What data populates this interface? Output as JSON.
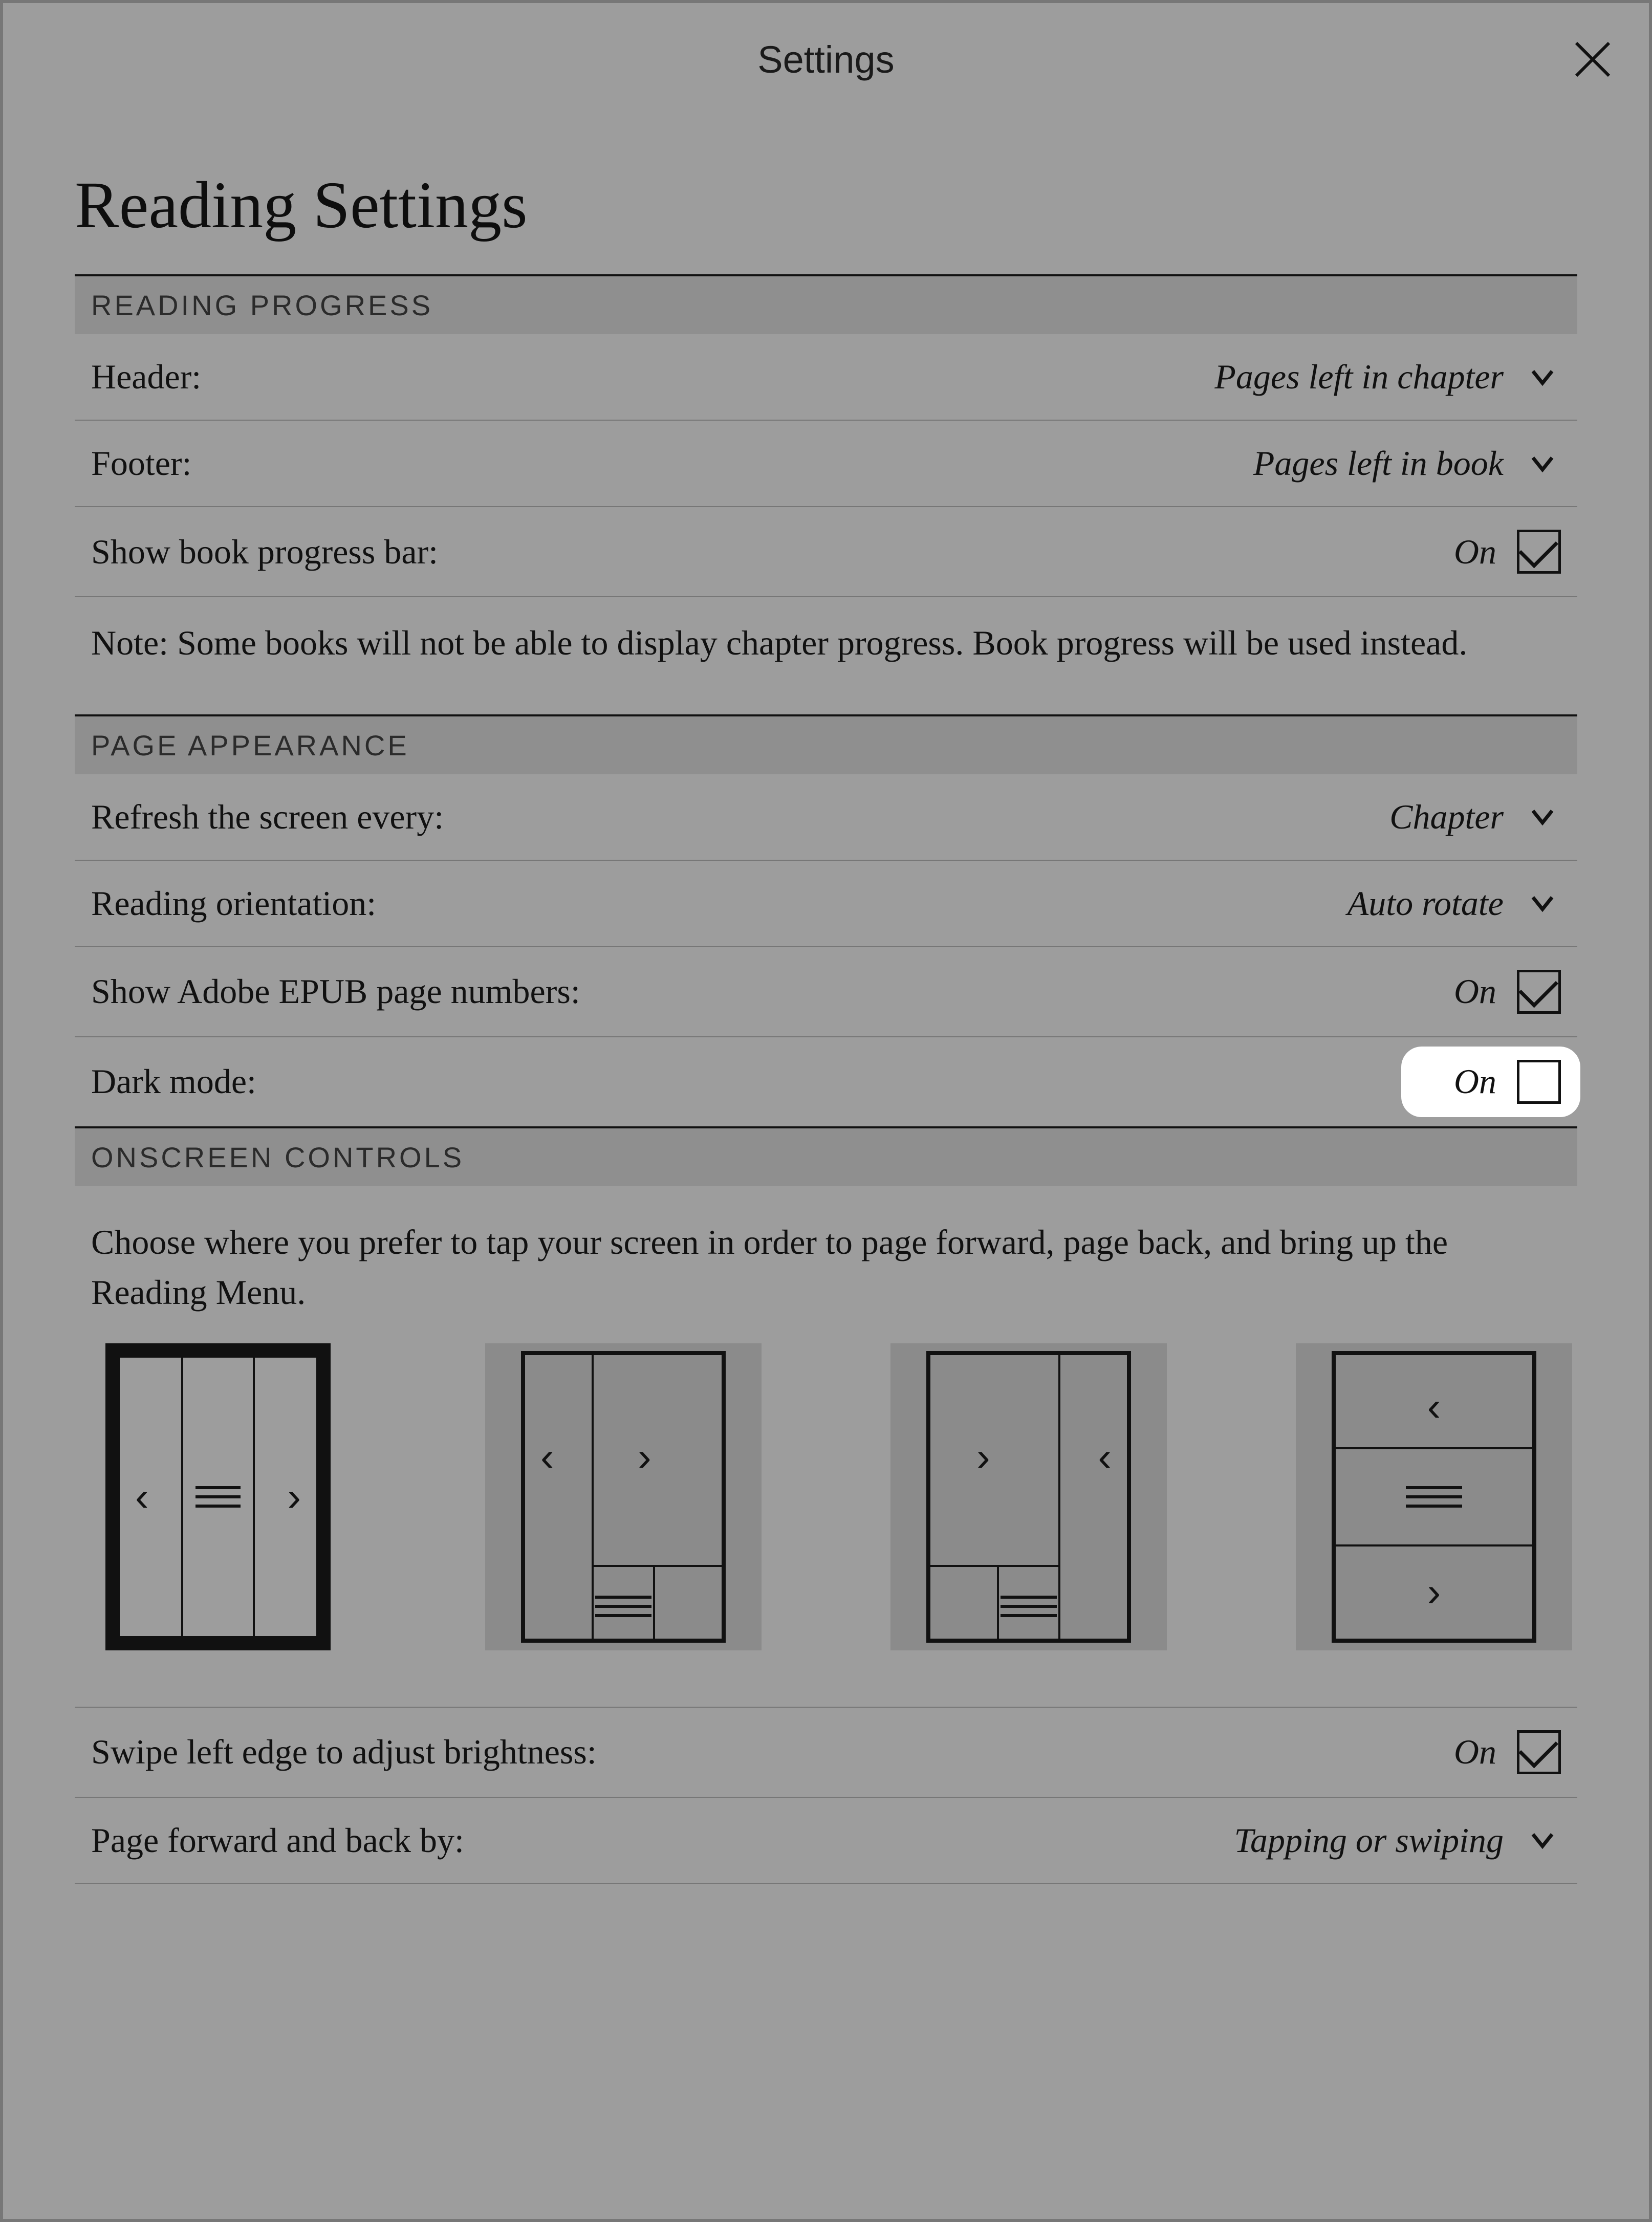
{
  "header": {
    "title": "Settings"
  },
  "page": {
    "title": "Reading Settings"
  },
  "sections": {
    "reading_progress": {
      "title": "READING PROGRESS",
      "header_label": "Header:",
      "header_value": "Pages left in chapter",
      "footer_label": "Footer:",
      "footer_value": "Pages left in book",
      "progressbar_label": "Show book progress bar:",
      "progressbar_value": "On",
      "note": "Note: Some books will not be able to display chapter progress. Book progress will be used instead."
    },
    "page_appearance": {
      "title": "PAGE APPEARANCE",
      "refresh_label": "Refresh the screen every:",
      "refresh_value": "Chapter",
      "orientation_label": "Reading orientation:",
      "orientation_value": "Auto rotate",
      "adobe_label": "Show Adobe EPUB page numbers:",
      "adobe_value": "On",
      "darkmode_label": "Dark mode:",
      "darkmode_value": "On"
    },
    "onscreen_controls": {
      "title": "ONSCREEN CONTROLS",
      "instructions": "Choose where you prefer to tap your screen in order to page forward, page back, and bring up the Reading Menu.",
      "swipe_label": "Swipe left edge to adjust brightness:",
      "swipe_value": "On",
      "pagefwd_label": "Page forward and back by:",
      "pagefwd_value": "Tapping or swiping"
    }
  }
}
